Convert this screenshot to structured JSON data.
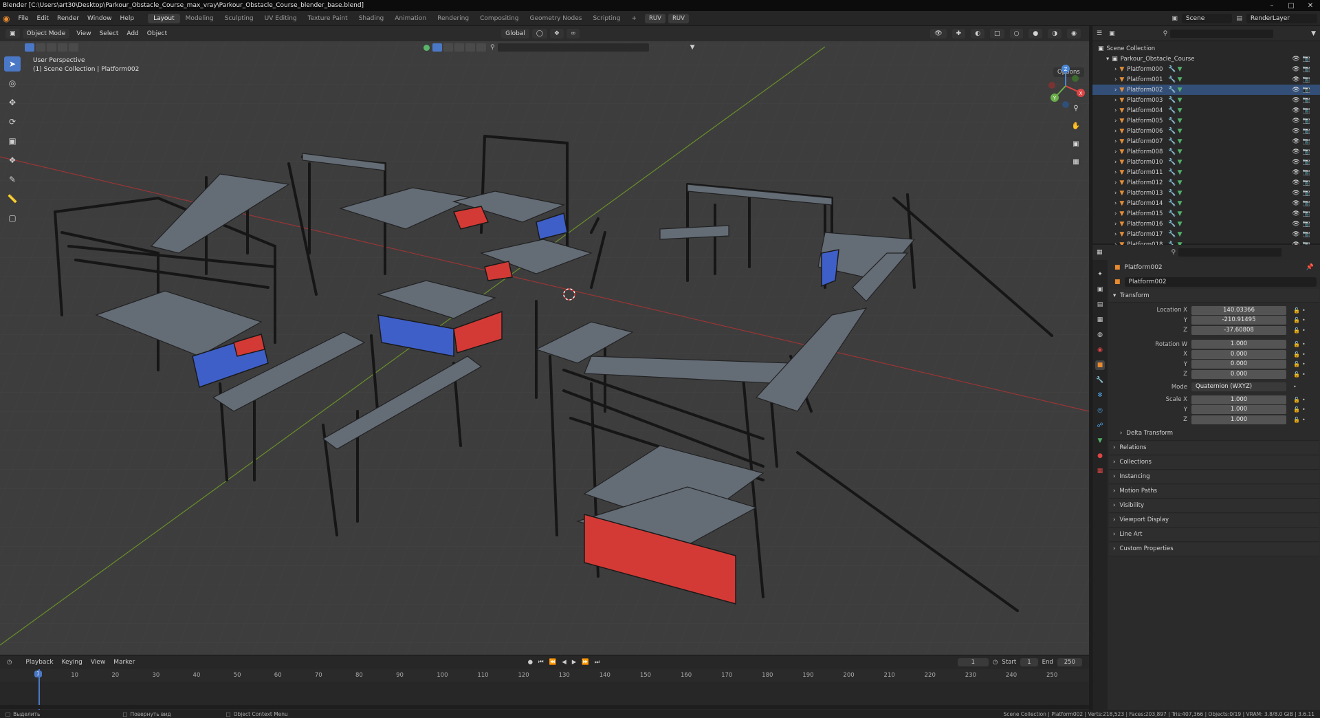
{
  "titlebar": {
    "title": "Blender [C:\\Users\\art30\\Desktop\\Parkour_Obstacle_Course_max_vray\\Parkour_Obstacle_Course_blender_base.blend]"
  },
  "menu": {
    "items": [
      "File",
      "Edit",
      "Render",
      "Window",
      "Help"
    ]
  },
  "workspaces": [
    "Layout",
    "Modeling",
    "Sculpting",
    "UV Editing",
    "Texture Paint",
    "Shading",
    "Animation",
    "Rendering",
    "Compositing",
    "Geometry Nodes",
    "Scripting"
  ],
  "ruv": [
    "RUV",
    "RUV"
  ],
  "scene": {
    "name": "Scene",
    "view_layer": "RenderLayer"
  },
  "viewport": {
    "mode": "Object Mode",
    "menus": [
      "View",
      "Select",
      "Add",
      "Object"
    ],
    "orientation": "Global",
    "options": "Options",
    "info_line1": "User Perspective",
    "info_line2": "(1) Scene Collection | Platform002",
    "axis_labels": {
      "x": "X",
      "y": "Y",
      "z": "Z"
    },
    "colors": {
      "background": "#3d3d3d",
      "red_panel": "#d43a35",
      "blue_panel": "#3f5fc8",
      "frame": "#1b1b1b",
      "platform": "#5e6670"
    }
  },
  "outliner": {
    "root": "Scene Collection",
    "collection": "Parkour_Obstacle_Course",
    "items": [
      "Platform000",
      "Platform001",
      "Platform002",
      "Platform003",
      "Platform004",
      "Platform005",
      "Platform006",
      "Platform007",
      "Platform008",
      "Platform010",
      "Platform011",
      "Platform012",
      "Platform013",
      "Platform014",
      "Platform015",
      "Platform016",
      "Platform017",
      "Platform018"
    ],
    "selected": "Platform002"
  },
  "properties": {
    "context": "Platform002",
    "object_name": "Platform002",
    "transform_header": "Transform",
    "location_label": "Location X",
    "location": [
      "140.03366",
      "-210.91495",
      "-37.60808"
    ],
    "rotation_label": "Rotation W",
    "rotation": [
      "1.000",
      "0.000",
      "0.000",
      "0.000"
    ],
    "mode_label": "Mode",
    "mode_value": "Quaternion (WXYZ)",
    "scale_label": "Scale X",
    "scale": [
      "1.000",
      "1.000",
      "1.000"
    ],
    "axis_y": "Y",
    "axis_z": "Z",
    "axis_x": "X",
    "panels": [
      "Delta Transform",
      "Relations",
      "Collections",
      "Instancing",
      "Motion Paths",
      "Visibility",
      "Viewport Display",
      "Line Art",
      "Custom Properties"
    ]
  },
  "timeline": {
    "menus": [
      "Playback",
      "Keying",
      "View",
      "Marker"
    ],
    "current_frame": "1",
    "start_label": "Start",
    "start": "1",
    "end_label": "End",
    "end": "250",
    "ticks": [
      "1",
      "10",
      "20",
      "30",
      "40",
      "50",
      "60",
      "70",
      "80",
      "90",
      "100",
      "110",
      "120",
      "130",
      "140",
      "150",
      "160",
      "170",
      "180",
      "190",
      "200",
      "210",
      "220",
      "230",
      "240",
      "250"
    ]
  },
  "statusbar": {
    "left1": "Выделить",
    "left2": "Повернуть вид",
    "left3": "Object Context Menu",
    "right": "Scene Collection | Platform002 | Verts:218,523 | Faces:203,897 | Tris:407,366 | Objects:0/19 | VRAM: 3.8/8.0 GiB | 3.6.11"
  }
}
